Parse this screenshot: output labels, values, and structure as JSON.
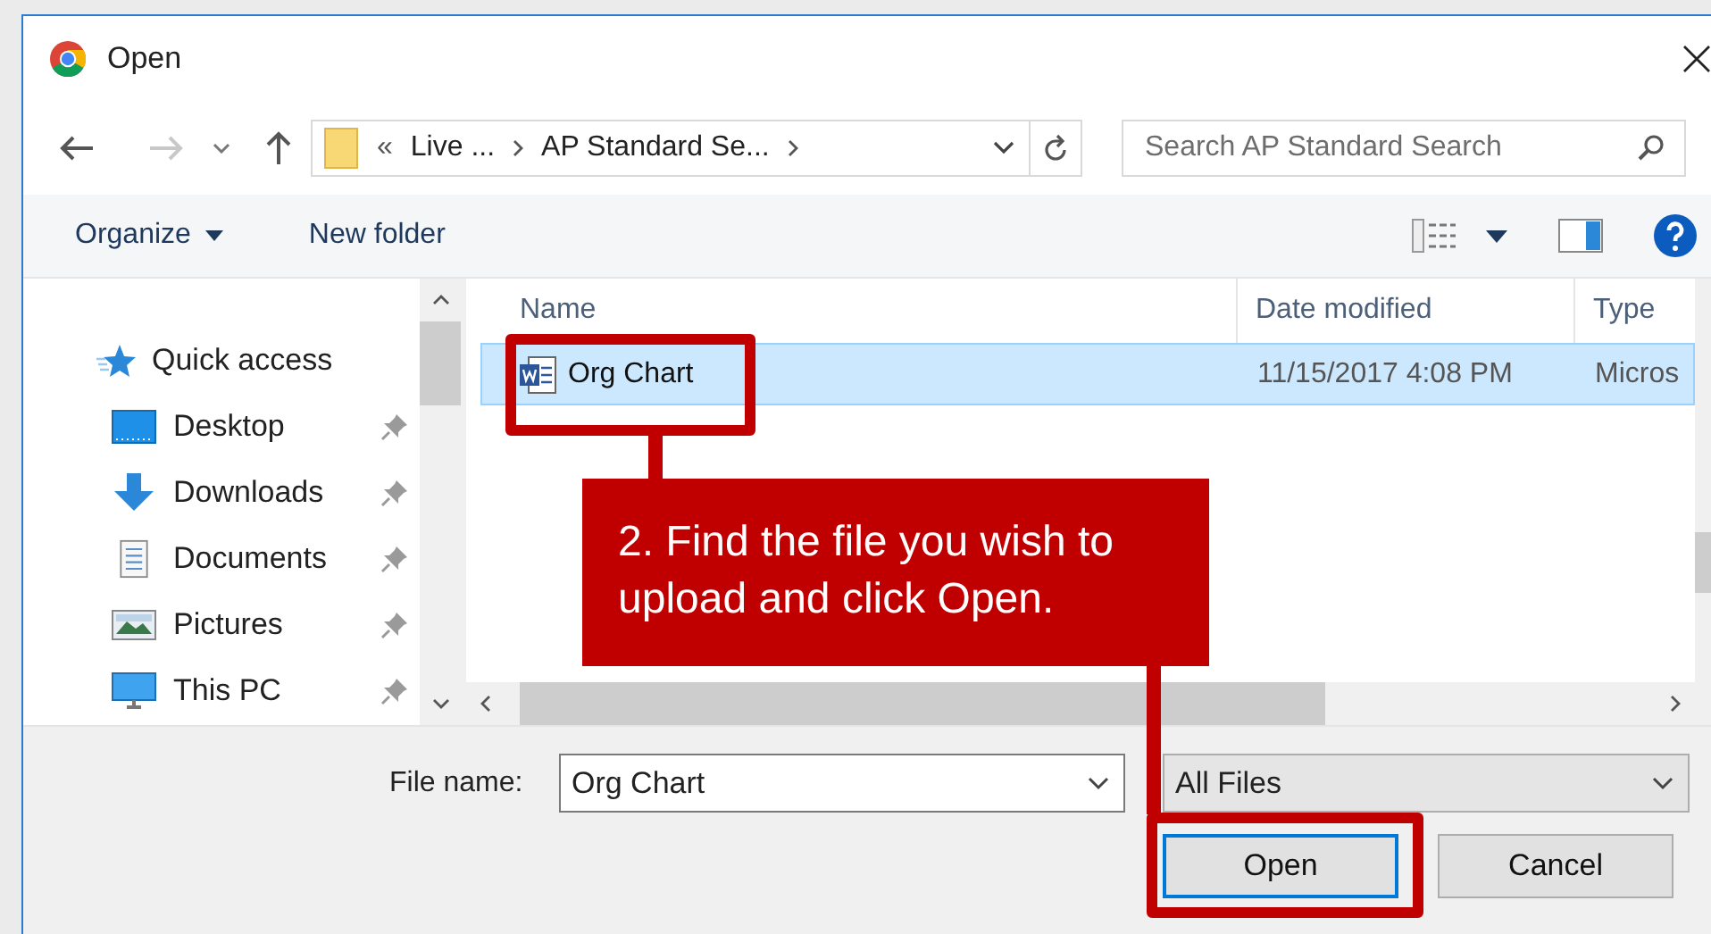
{
  "window": {
    "title": "Open"
  },
  "address_bar": {
    "overflow": "«",
    "crumbs": [
      "Live ...",
      "AP Standard Se..."
    ]
  },
  "search": {
    "placeholder": "Search AP Standard Search"
  },
  "toolbar": [
    {
      "label": "Organize",
      "dropdown": true
    },
    {
      "label": "New folder",
      "dropdown": false
    }
  ],
  "sidebar": {
    "items": [
      {
        "label": "Quick access",
        "kind": "quick",
        "pinned": false
      },
      {
        "label": "Desktop",
        "kind": "desktop",
        "pinned": true
      },
      {
        "label": "Downloads",
        "kind": "downloads",
        "pinned": true
      },
      {
        "label": "Documents",
        "kind": "documents",
        "pinned": true
      },
      {
        "label": "Pictures",
        "kind": "pictures",
        "pinned": true
      },
      {
        "label": "This PC",
        "kind": "pc",
        "pinned": true
      }
    ]
  },
  "table": {
    "columns": [
      "Name",
      "Date modified",
      "Type"
    ],
    "rows": [
      {
        "name": "Org Chart",
        "date_modified": "11/15/2017 4:08 PM",
        "type": "Micros",
        "selected": true
      }
    ]
  },
  "file_name": {
    "label": "File name:",
    "value": "Org Chart"
  },
  "file_type": {
    "value": "All Files"
  },
  "buttons": [
    {
      "label": "Open",
      "default": true
    },
    {
      "label": "Cancel",
      "default": false
    }
  ],
  "callout": {
    "text": "2. Find the file you wish to upload and click Open."
  }
}
